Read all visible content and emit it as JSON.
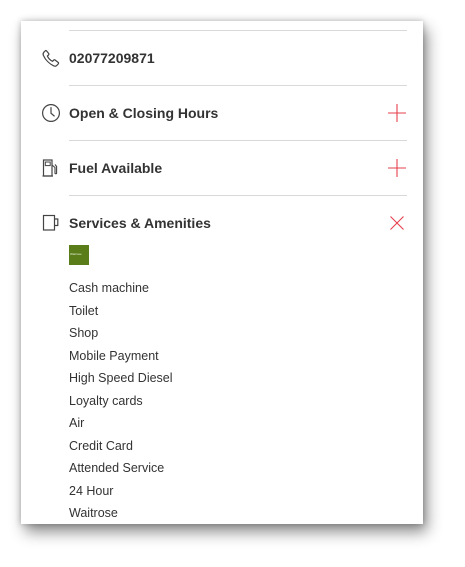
{
  "phone": {
    "number": "02077209871",
    "icon": "phone-icon"
  },
  "sections": {
    "hours": {
      "title": "Open & Closing Hours",
      "icon": "clock-icon",
      "toggle": "plus-icon"
    },
    "fuel": {
      "title": "Fuel Available",
      "icon": "fuel-pump-icon",
      "toggle": "plus-icon"
    },
    "services": {
      "title": "Services & Amenities",
      "icon": "coffee-cup-icon",
      "toggle": "close-icon",
      "logo_text": "Waitrose",
      "items": [
        "Cash machine",
        "Toilet",
        "Shop",
        "Mobile Payment",
        "High Speed Diesel",
        "Loyalty cards",
        "Air",
        "Credit Card",
        "Attended Service",
        "24 Hour",
        "Waitrose"
      ]
    }
  },
  "colors": {
    "accent": "#e5404d",
    "text": "#333333",
    "icon": "#444444",
    "divider": "#d9d9d9",
    "logo_bg": "#5a7d1a"
  }
}
